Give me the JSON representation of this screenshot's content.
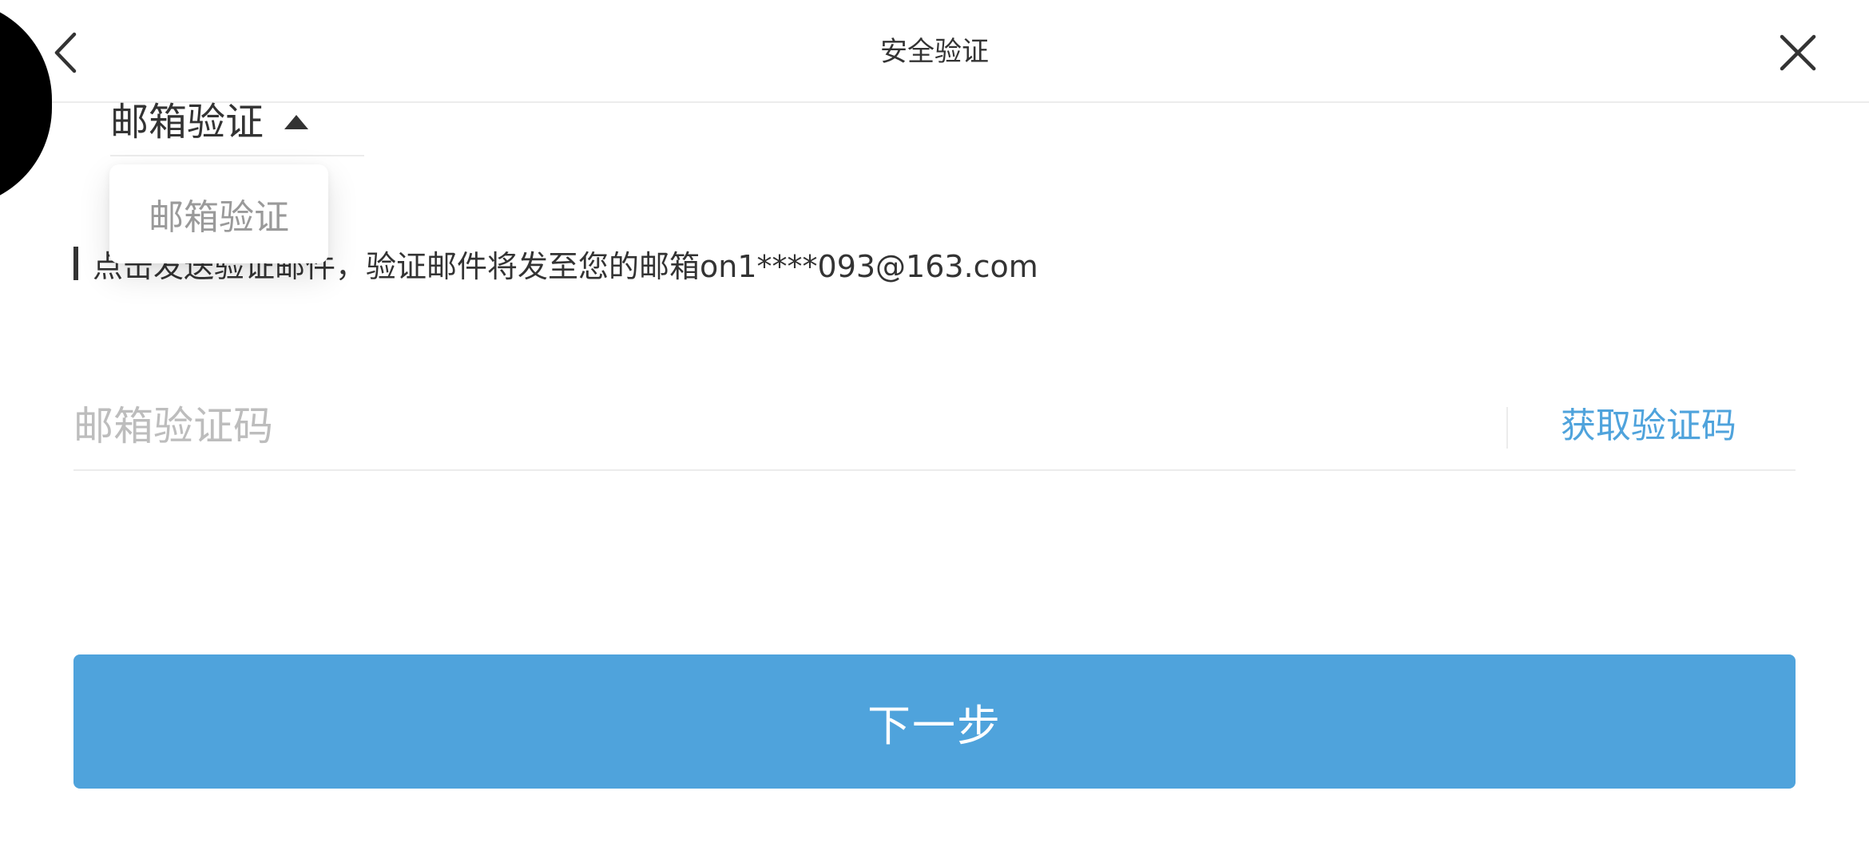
{
  "header": {
    "title": "安全验证",
    "back_icon": "chevron-left-icon",
    "close_icon": "close-icon"
  },
  "side_tool": {
    "icon": "puzzle-icon"
  },
  "method_selector": {
    "selected": "邮箱验证",
    "caret_icon": "caret-up-icon",
    "options": [
      "邮箱验证"
    ]
  },
  "info": {
    "text": "点击发送验证邮件，验证邮件将发至您的邮箱on1****093@163.com"
  },
  "code_field": {
    "placeholder": "邮箱验证码",
    "value": "",
    "get_code_label": "获取验证码"
  },
  "next_button": {
    "label": "下一步"
  },
  "colors": {
    "accent": "#4fa3dc",
    "text": "#333333",
    "placeholder": "#bdbdbd",
    "divider": "#ececec"
  }
}
